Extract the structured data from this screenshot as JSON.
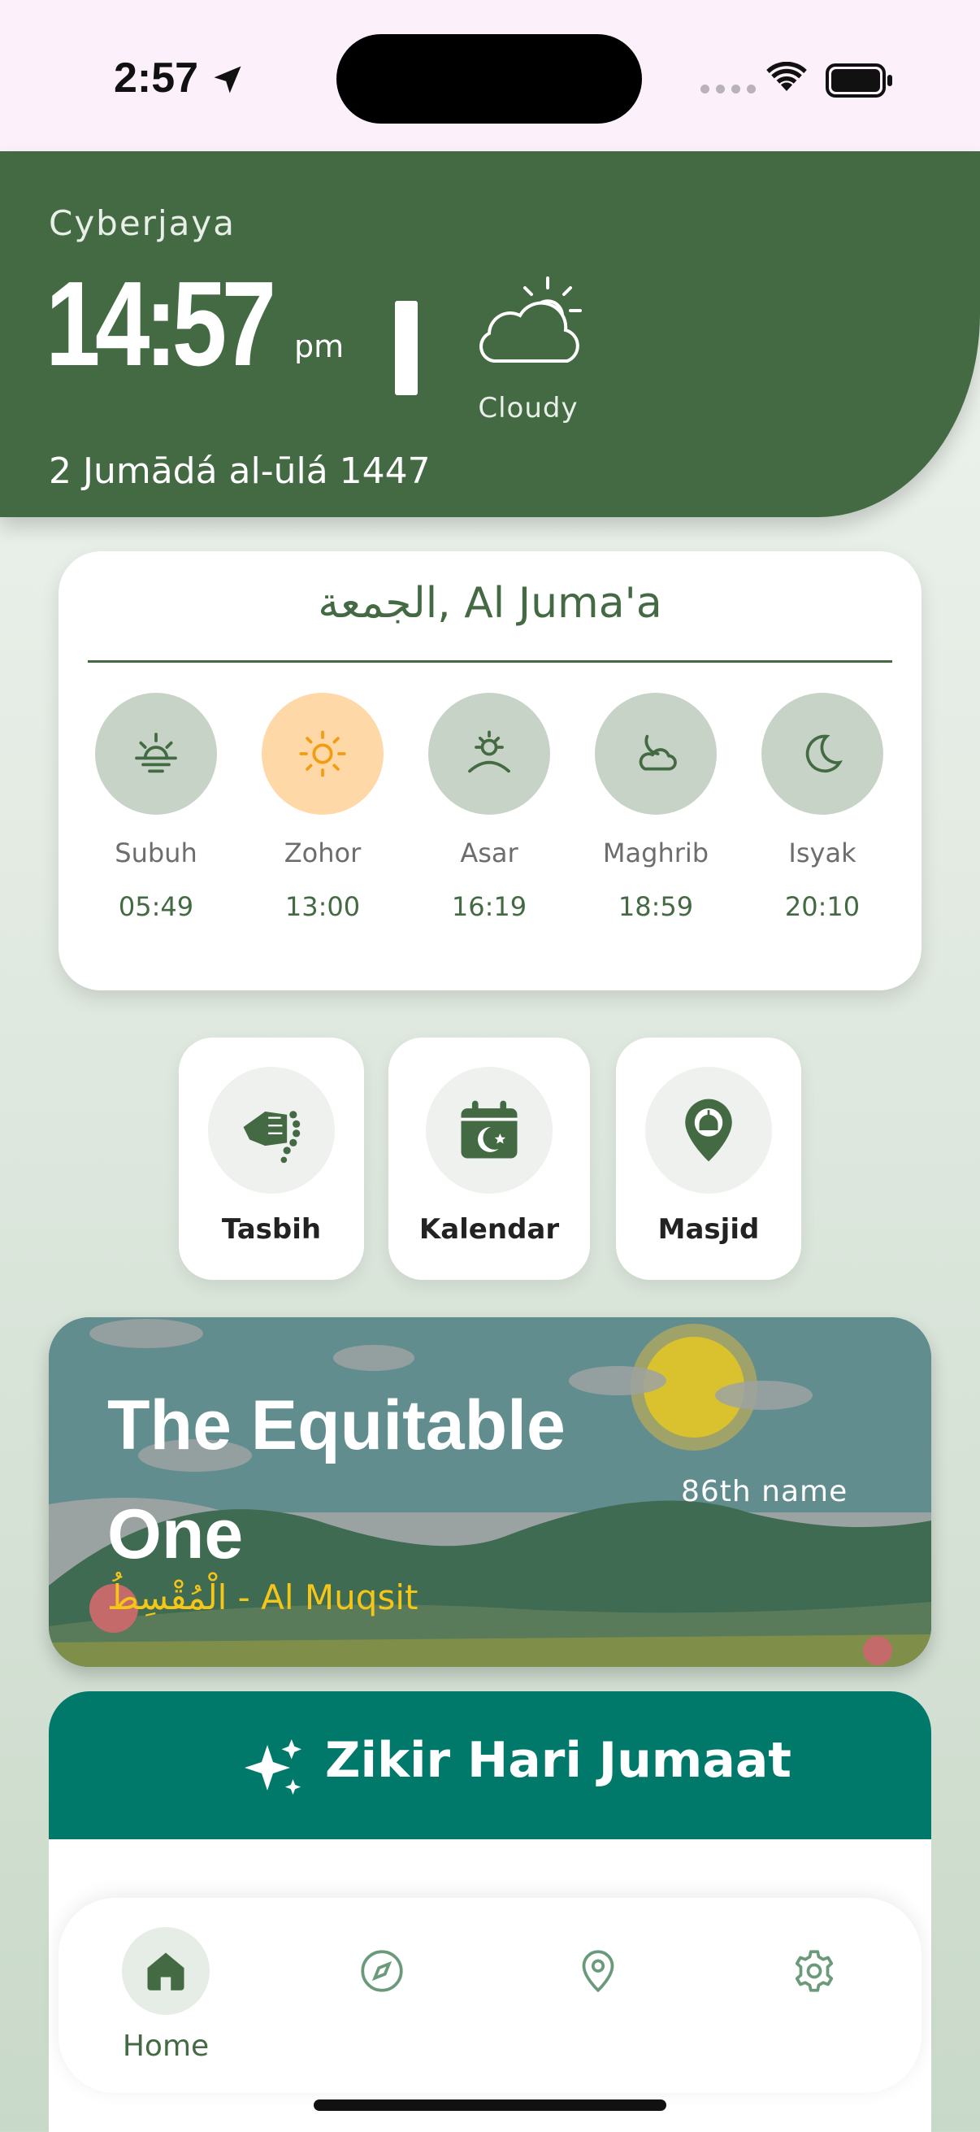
{
  "status_bar": {
    "time": "2:57"
  },
  "header": {
    "city": "Cyberjaya",
    "time": "14:57",
    "ampm": "pm",
    "weather": "Cloudy",
    "hijri_date": "2 Jumādá al-ūlá 1447"
  },
  "prayer_card": {
    "day_title": "الجمعة, Al Juma'a",
    "prayers": [
      {
        "name": "Subuh",
        "time": "05:49",
        "icon": "sunrise-icon",
        "active": false
      },
      {
        "name": "Zohor",
        "time": "13:00",
        "icon": "sun-icon",
        "active": true
      },
      {
        "name": "Asar",
        "time": "16:19",
        "icon": "sun-horizon-icon",
        "active": false
      },
      {
        "name": "Maghrib",
        "time": "18:59",
        "icon": "moon-cloud-icon",
        "active": false
      },
      {
        "name": "Isyak",
        "time": "20:10",
        "icon": "moon-icon",
        "active": false
      }
    ]
  },
  "shortcuts": [
    {
      "label": "Tasbih",
      "icon": "tasbih-hand-icon"
    },
    {
      "label": "Kalendar",
      "icon": "calendar-moon-icon"
    },
    {
      "label": "Masjid",
      "icon": "mosque-pin-icon"
    }
  ],
  "asma": {
    "title": "The Equitable One",
    "number": "86th name",
    "arabic": "الْمُقْسِطُ - Al Muqsit"
  },
  "zikir": {
    "title": "Zikir Hari Jumaat"
  },
  "nav": {
    "items": [
      {
        "label": "Home",
        "icon": "home-icon",
        "active": true
      },
      {
        "label": "",
        "icon": "compass-icon",
        "active": false
      },
      {
        "label": "",
        "icon": "location-pin-icon",
        "active": false
      },
      {
        "label": "",
        "icon": "gear-icon",
        "active": false
      }
    ]
  },
  "colors": {
    "primary_green": "#436a43",
    "active_prayer": "#ffd8a8",
    "zikir_teal": "#00796b",
    "asma_gold": "#f5c518"
  }
}
